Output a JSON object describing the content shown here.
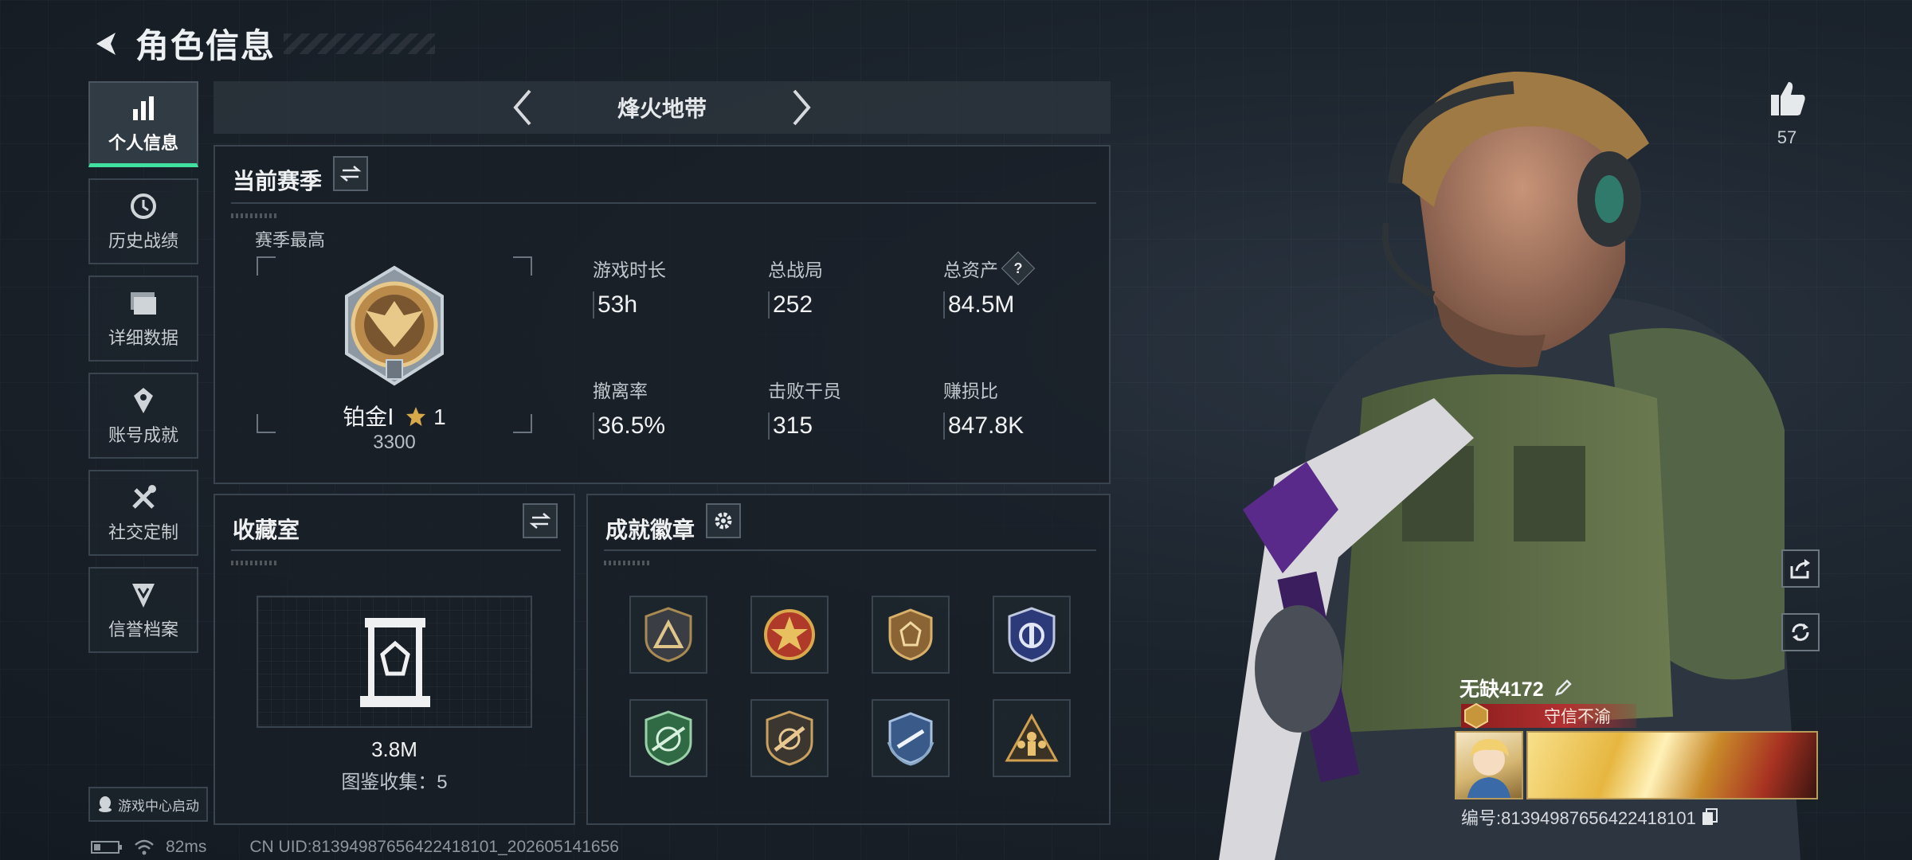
{
  "header": {
    "title": "角色信息"
  },
  "sidebar": {
    "items": [
      {
        "label": "个人信息",
        "icon": "bar-chart-icon",
        "active": true
      },
      {
        "label": "历史战绩",
        "icon": "history-clock-icon",
        "active": false
      },
      {
        "label": "详细数据",
        "icon": "folder-icon",
        "active": false
      },
      {
        "label": "账号成就",
        "icon": "achievement-icon",
        "active": false
      },
      {
        "label": "社交定制",
        "icon": "tools-icon",
        "active": false
      },
      {
        "label": "信誉档案",
        "icon": "credit-shield-icon",
        "active": false
      }
    ],
    "launch_label": "游戏中心启动"
  },
  "mode": {
    "name": "烽火地带"
  },
  "season": {
    "title": "当前赛季",
    "best_label": "赛季最高",
    "rank_name": "铂金Ⅰ",
    "rank_stars": "1",
    "rank_score": "3300",
    "stats": [
      {
        "label": "游戏时长",
        "value": "53h"
      },
      {
        "label": "总战局",
        "value": "252"
      },
      {
        "label": "总资产",
        "value": "84.5M",
        "help": "?"
      },
      {
        "label": "撤离率",
        "value": "36.5%"
      },
      {
        "label": "击败干员",
        "value": "315"
      },
      {
        "label": "赚损比",
        "value": "847.8K"
      }
    ]
  },
  "collection": {
    "title": "收藏室",
    "value": "3.8M",
    "count_text": "图鉴收集：5"
  },
  "badges": {
    "title": "成就徽章",
    "items": [
      "triangle-badge-icon",
      "star-medal-icon",
      "gem-shield-icon",
      "blue-crest-icon",
      "green-rifle-badge-icon",
      "bronze-rifle-badge-icon",
      "blue-wreath-badge-icon",
      "soldiers-badge-icon"
    ]
  },
  "social": {
    "likes": "57"
  },
  "player": {
    "name": "无缺4172",
    "honor": "守信不渝",
    "id_text": "编号:813949876564224181​01"
  },
  "status": {
    "ping": "82ms",
    "uid": "CN UID:813949876564224181​01_202605141656"
  },
  "colors": {
    "accent": "#3fe0a0",
    "honor_red": "#b23030",
    "gold": "#d7a94a"
  }
}
